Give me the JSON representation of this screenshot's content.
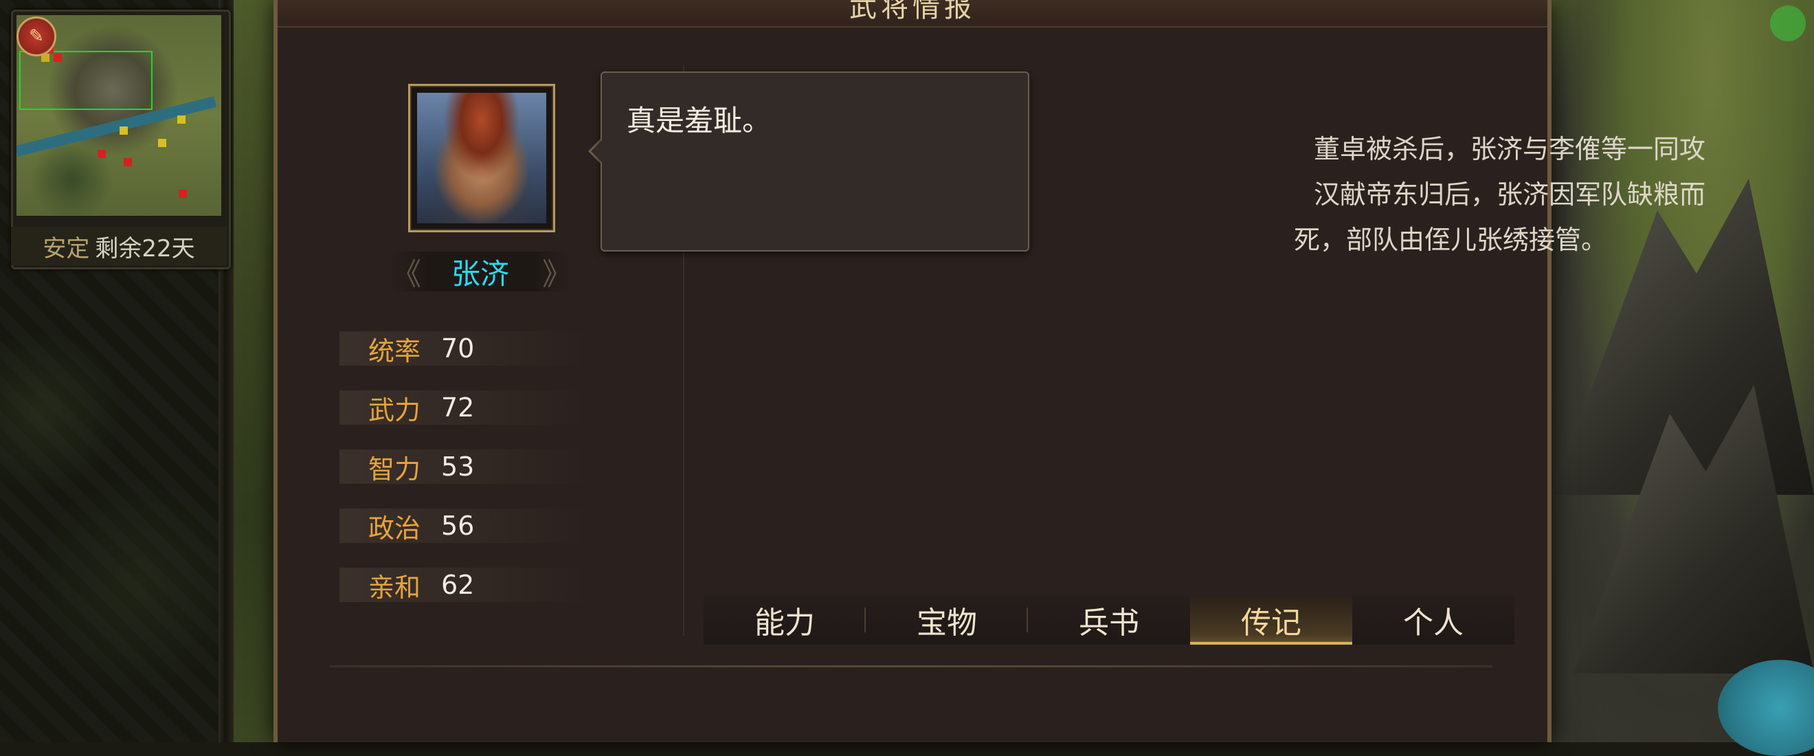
{
  "dialog": {
    "title": "武将情报"
  },
  "minimap": {
    "badge_icon": "seal-icon",
    "status_label": "安定",
    "status_value": "剩余22天"
  },
  "general": {
    "name": "张济",
    "stats": [
      {
        "label": "统率",
        "value": "70"
      },
      {
        "label": "武力",
        "value": "72"
      },
      {
        "label": "智力",
        "value": "53"
      },
      {
        "label": "政治",
        "value": "56"
      },
      {
        "label": "亲和",
        "value": "62"
      }
    ]
  },
  "speech": {
    "text": "真是羞耻。"
  },
  "biography": {
    "lines": [
      "董卓被杀后，张济与李傕等一同攻",
      "汉献帝东归后，张济因军队缺粮而",
      "死，部队由侄儿张绣接管。"
    ]
  },
  "tabs": [
    {
      "label": "能力",
      "active": false
    },
    {
      "label": "宝物",
      "active": false
    },
    {
      "label": "兵书",
      "active": false
    },
    {
      "label": "传记",
      "active": true
    },
    {
      "label": "个人",
      "active": false
    }
  ],
  "colors": {
    "name": "#2fd8f0",
    "stat_label": "#e7a43b",
    "active_tab": "#d8b25c"
  }
}
